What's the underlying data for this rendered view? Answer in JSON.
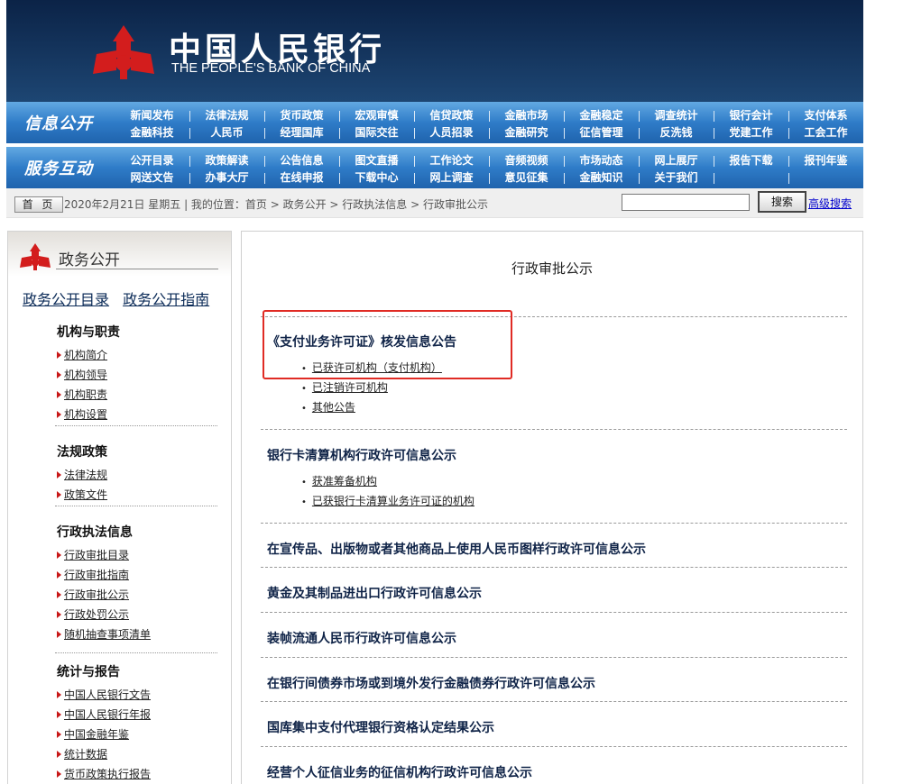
{
  "banner": {
    "cn_title": "中国人民银行",
    "en_title": "THE PEOPLE'S BANK OF CHINA",
    "colors": {
      "bg": "#0b2347",
      "logo": "#d31d1d"
    }
  },
  "nav_info": {
    "label": "信息公开",
    "row1": [
      "新闻发布",
      "法律法规",
      "货币政策",
      "宏观审慎",
      "信贷政策",
      "金融市场",
      "金融稳定",
      "调查统计",
      "银行会计",
      "支付体系"
    ],
    "row2": [
      "金融科技",
      "人民币",
      "经理国库",
      "国际交往",
      "人员招录",
      "金融研究",
      "征信管理",
      "反洗钱",
      "党建工作",
      "工会工作"
    ]
  },
  "nav_service": {
    "label": "服务互动",
    "row1": [
      "公开目录",
      "政策解读",
      "公告信息",
      "图文直播",
      "工作论文",
      "音频视频",
      "市场动态",
      "网上展厅",
      "报告下载",
      "报刊年鉴"
    ],
    "row2": [
      "网送文告",
      "办事大厅",
      "在线申报",
      "下载中心",
      "网上调查",
      "意见征集",
      "金融知识",
      "关于我们",
      "",
      ""
    ]
  },
  "location": {
    "home_label": "首 页",
    "text": "2020年2月21日 星期五 | 我的位置：首页 > 政务公开 > 行政执法信息 > 行政审批公示",
    "search_placeholder": "",
    "search_button": "搜索",
    "advanced_search": "高级搜索"
  },
  "sidebar": {
    "title": "政务公开",
    "link_directory": "政务公开目录",
    "link_guide": "政务公开指南",
    "groups": [
      {
        "title": "机构与职责",
        "items": [
          "机构简介",
          "机构领导",
          "机构职责",
          "机构设置"
        ]
      },
      {
        "title": "法规政策",
        "items": [
          "法律法规",
          "政策文件"
        ]
      },
      {
        "title": "行政执法信息",
        "items": [
          "行政审批目录",
          "行政审批指南",
          "行政审批公示",
          "行政处罚公示",
          "随机抽查事项清单"
        ]
      },
      {
        "title": "统计与报告",
        "items": [
          "中国人民银行文告",
          "中国人民银行年报",
          "中国金融年鉴",
          "统计数据",
          "货币政策执行报告"
        ]
      }
    ]
  },
  "main": {
    "title": "行政审批公示",
    "sections": [
      {
        "title": "《支付业务许可证》核发信息公告",
        "items": [
          "已获许可机构（支付机构）",
          "已注销许可机构",
          "其他公告"
        ]
      },
      {
        "title": "银行卡清算机构行政许可信息公示",
        "items": [
          "获准筹备机构",
          "已获银行卡清算业务许可证的机构"
        ]
      },
      {
        "title": "在宣传品、出版物或者其他商品上使用人民币图样行政许可信息公示",
        "items": []
      },
      {
        "title": "黄金及其制品进出口行政许可信息公示",
        "items": []
      },
      {
        "title": "装帧流通人民币行政许可信息公示",
        "items": []
      },
      {
        "title": "在银行间债券市场或到境外发行金融债券行政许可信息公示",
        "items": []
      },
      {
        "title": "国库集中支付代理银行资格认定结果公示",
        "items": []
      },
      {
        "title": "经营个人征信业务的征信机构行政许可信息公示",
        "items": []
      }
    ],
    "highlight_color": "#e02b24"
  }
}
